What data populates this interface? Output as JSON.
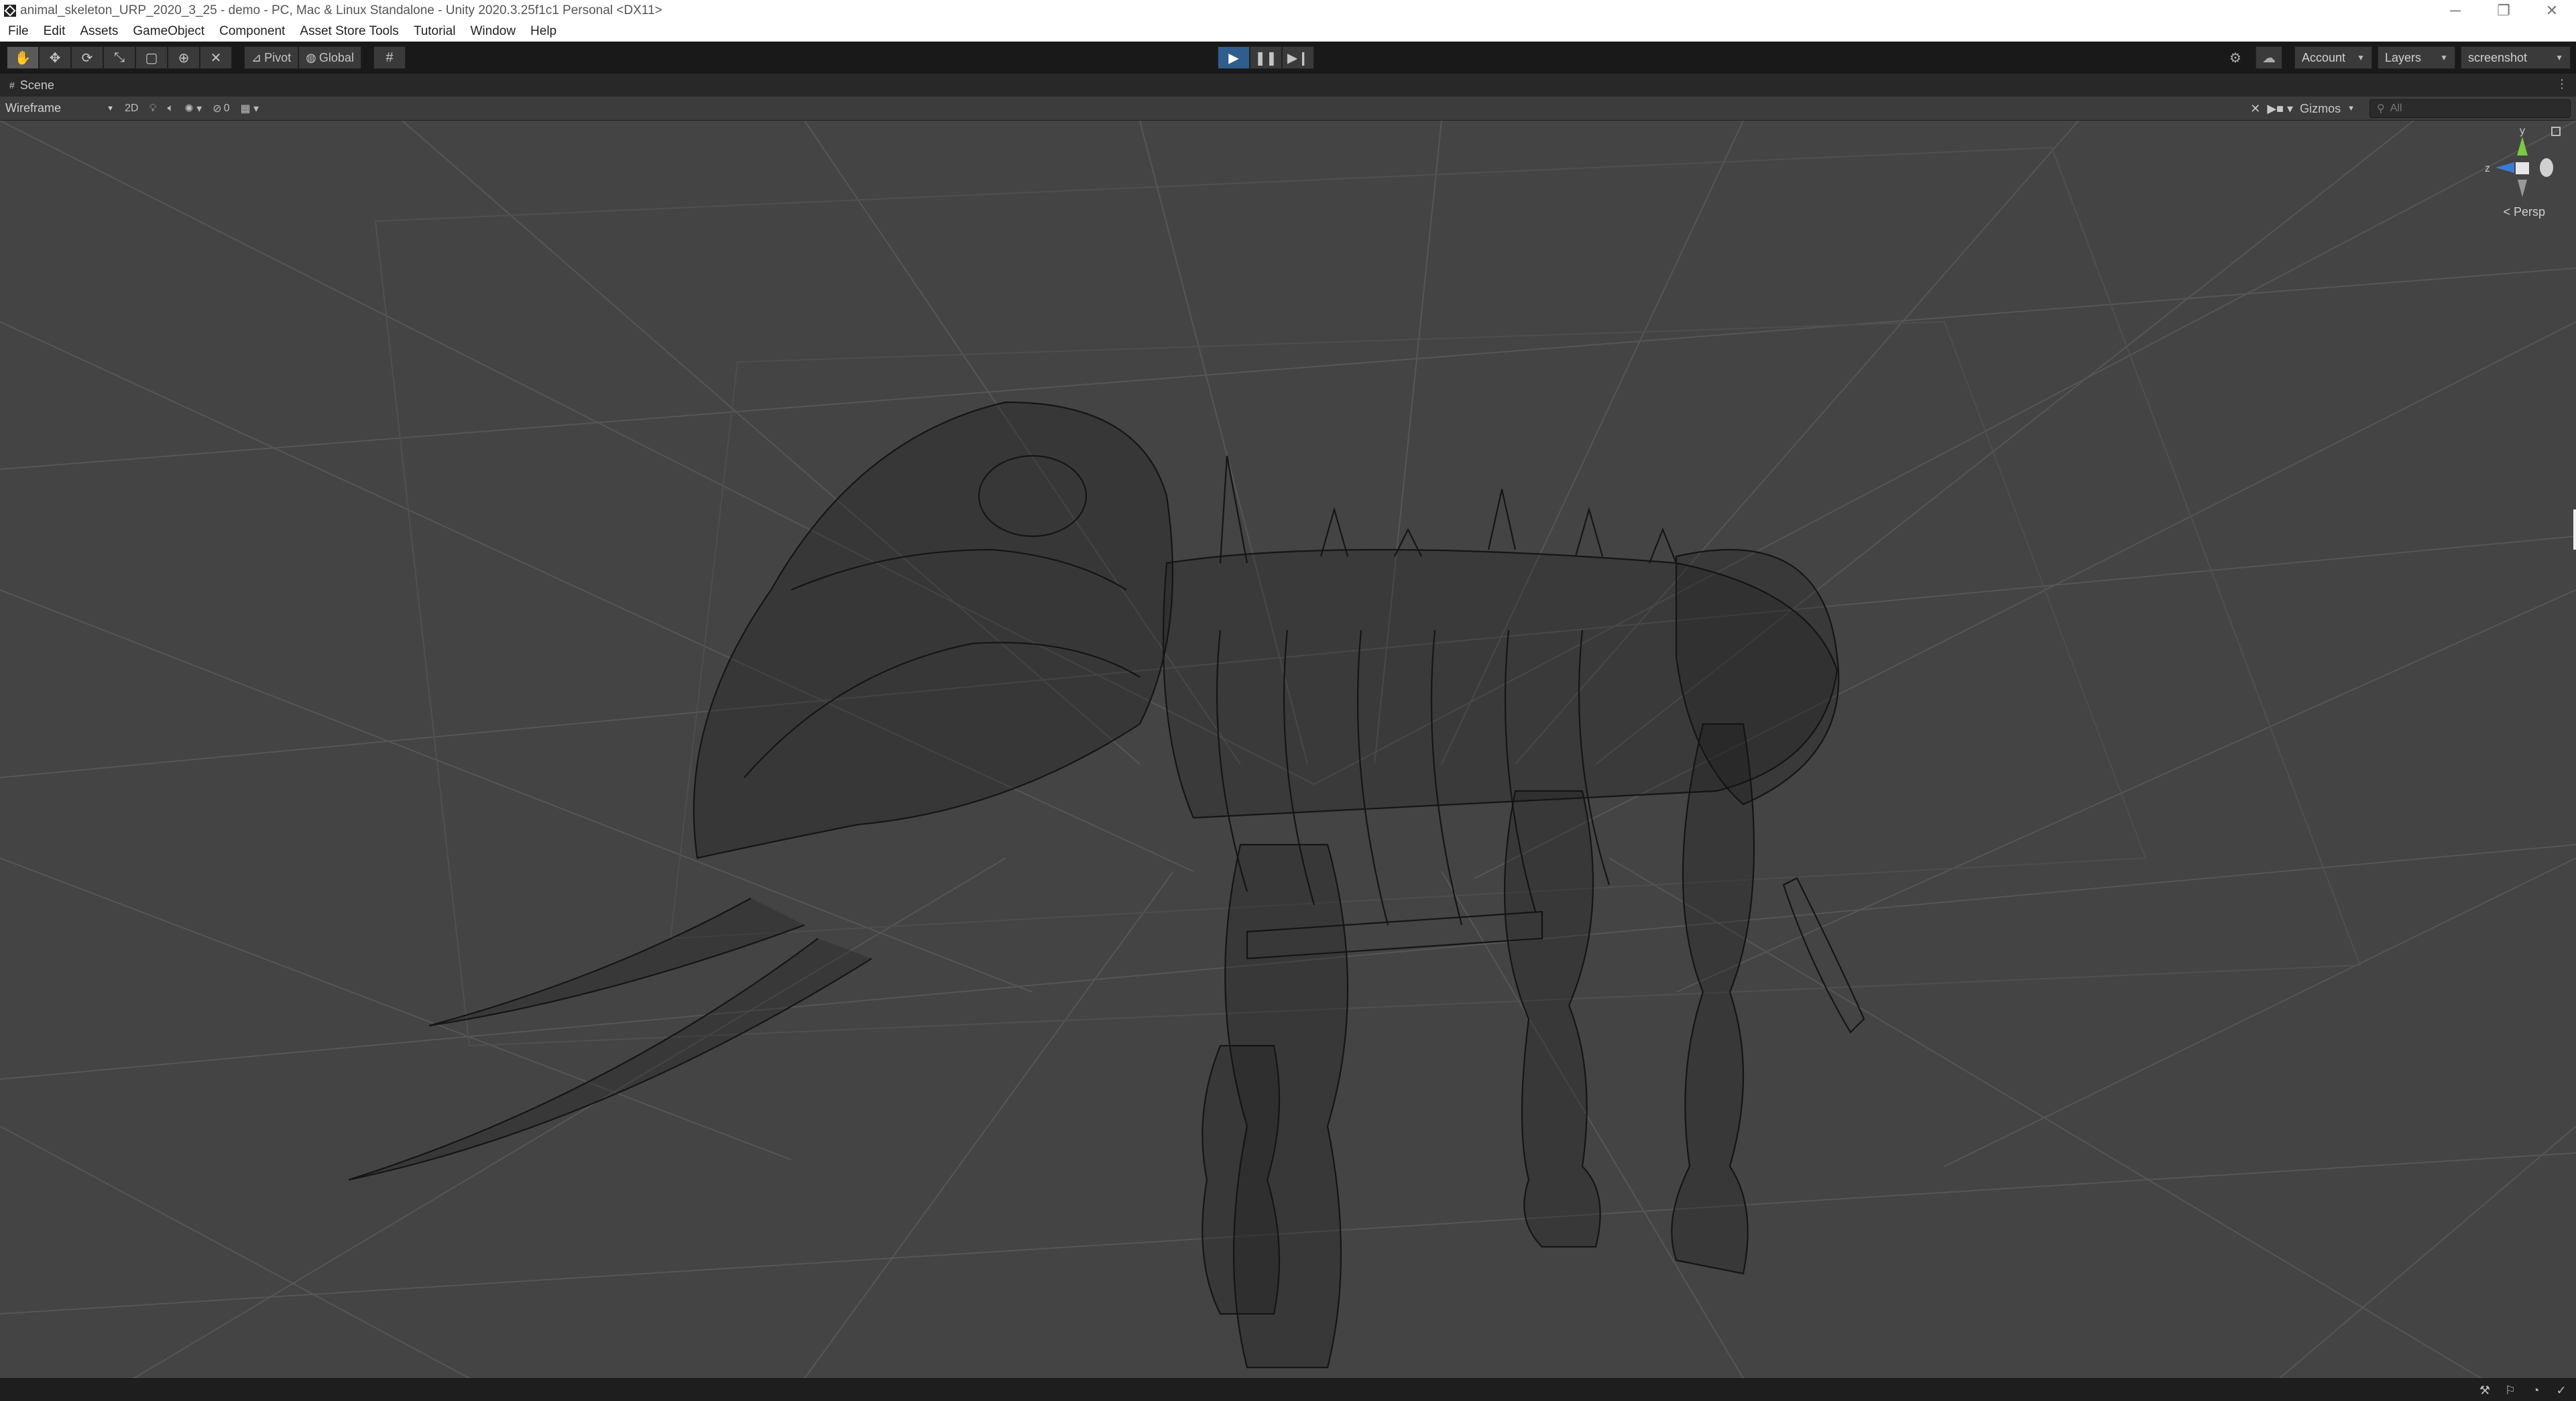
{
  "window": {
    "title": "animal_skeleton_URP_2020_3_25 - demo - PC, Mac & Linux Standalone - Unity 2020.3.25f1c1 Personal <DX11>",
    "minimize": "─",
    "maximize": "❐",
    "close": "✕"
  },
  "menu": [
    "File",
    "Edit",
    "Assets",
    "GameObject",
    "Component",
    "Asset Store Tools",
    "Tutorial",
    "Window",
    "Help"
  ],
  "toolbar": {
    "pivot_label": "Pivot",
    "global_label": "Global",
    "account_label": "Account",
    "layers_label": "Layers",
    "layout_label": "screenshot"
  },
  "scene": {
    "tab_label": "Scene",
    "draw_mode": "Wireframe",
    "two_d_label": "2D",
    "hidden_count": "0",
    "gizmos_label": "Gizmos",
    "search_placeholder": "All",
    "projection_label": "Persp",
    "axis_labels": {
      "y": "y",
      "z": "z"
    }
  },
  "colors": {
    "viewport_bg": "#444444",
    "wire": "#141414",
    "grid": "#555555",
    "play_active": "#2f5d8d",
    "axis_y": "#7ac943",
    "axis_z": "#3a7bd5",
    "axis_x": "#d0d0d0"
  }
}
